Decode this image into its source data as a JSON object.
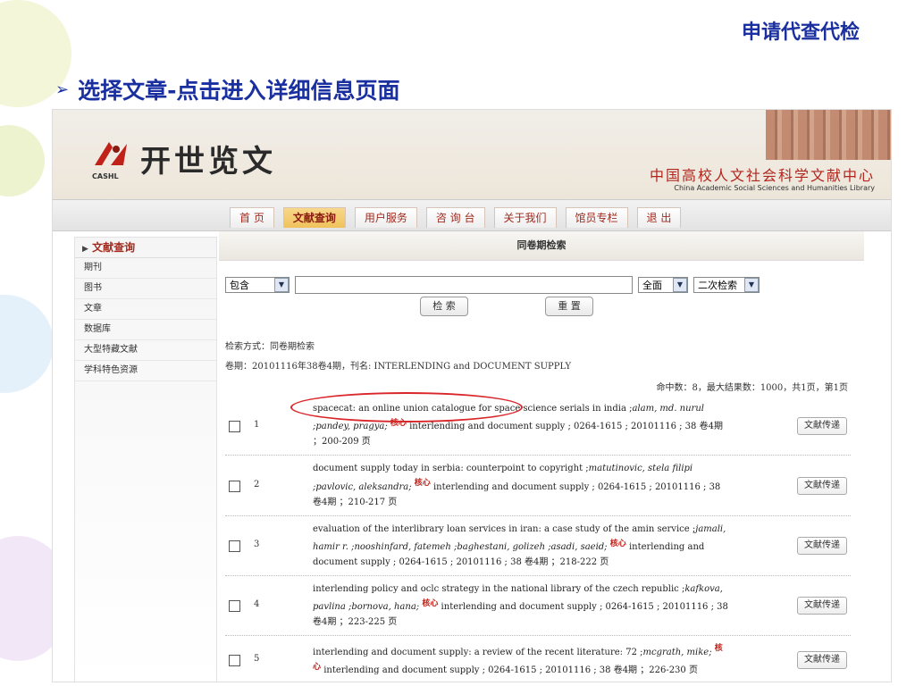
{
  "slide": {
    "corner_label": "申请代查代检",
    "heading": "选择文章-点击进入详细信息页面"
  },
  "site": {
    "logo_short": "CASHL",
    "logo_name": "开世览文",
    "center_name_cn": "中国高校人文社会科学文献中心",
    "center_name_en": "China Academic Social Sciences and Humanities Library"
  },
  "nav": [
    "首 页",
    "文献查询",
    "用户服务",
    "咨 询 台",
    "关于我们",
    "馆员专栏",
    "退 出"
  ],
  "nav_active_index": 1,
  "sidebar": {
    "title": "文献查询",
    "items": [
      "期刊",
      "图书",
      "文章",
      "数据库",
      "大型特藏文献",
      "学科特色资源"
    ]
  },
  "search": {
    "panel_title": "同卷期检索",
    "match_select": "包含",
    "query_value": "",
    "field_select": "全面",
    "mode_select": "二次检索",
    "search_button": "检 索",
    "reset_button": "重 置"
  },
  "meta": {
    "method": "检索方式：同卷期检索",
    "issue": "卷期：20101116年38卷4期，刊名: INTERLENDING and DOCUMENT SUPPLY",
    "hits": "命中数：8，最大结果数：1000，共1页，第1页"
  },
  "results": [
    {
      "num": "1",
      "title": "spacecat: an online union catalogue for space science serials in india ;",
      "authors": "alam, md. nurul ;pandey, pragya;",
      "core": "核心",
      "source": " interlending and document supply ; 0264-1615 ; 20101116 ; 38 卷4期 ；200-209 页",
      "action": "文献传递"
    },
    {
      "num": "2",
      "title": "document supply today in serbia: counterpoint to copyright ;",
      "authors": "matutinovic, stela filipi ;pavlovic, aleksandra;",
      "core": "核心",
      "source": " interlending and document supply ; 0264-1615 ; 20101116 ; 38 卷4期 ；210-217 页",
      "action": "文献传递"
    },
    {
      "num": "3",
      "title": "evaluation of the interlibrary loan services in iran: a case study of the amin service ;",
      "authors": "jamali, hamir r. ;nooshinfard, fatemeh ;baghestani, golizeh ;asadi, saeid;",
      "core": "核心",
      "source": " interlending and document supply ; 0264-1615 ; 20101116 ; 38 卷4期 ；218-222 页",
      "action": "文献传递"
    },
    {
      "num": "4",
      "title": "interlending policy and oclc strategy in the national library of the czech republic ;",
      "authors": "kafkova, pavlina ;bornova, hana;",
      "core": "核心",
      "source": " interlending and document supply ; 0264-1615 ; 20101116 ; 38 卷4期 ；223-225 页",
      "action": "文献传递"
    },
    {
      "num": "5",
      "title": "interlending and document supply: a review of the recent literature: 72 ;",
      "authors": "mcgrath, mike;",
      "core": "核心",
      "source": " interlending and document supply ; 0264-1615 ; 20101116 ; 38 卷4期 ；226-230 页",
      "action": "文献传递"
    }
  ],
  "colors": {
    "slide_text": "#1a2fa0",
    "brand_red": "#a12a1e",
    "highlight_oval": "#d9262a"
  }
}
